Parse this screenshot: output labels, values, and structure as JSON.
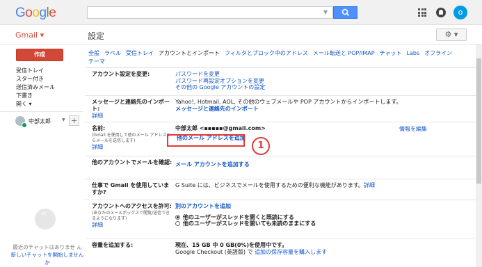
{
  "header": {
    "logo_text": "Google",
    "search_placeholder": "",
    "avatar_initial": "o"
  },
  "subbar": {
    "app_label": "Gmail ▾",
    "page_title": "設定",
    "gear_label": "⚙ ▾"
  },
  "sidebar": {
    "compose_label": "作成",
    "items": [
      {
        "label": "受信トレイ"
      },
      {
        "label": "スター付き"
      },
      {
        "label": "送信済みメール"
      },
      {
        "label": "下書き"
      },
      {
        "label": "開く ▾"
      }
    ],
    "user_name": "中部太郎",
    "user_caret": "▼",
    "add_label": "+",
    "chat_empty_text": "最近のチャットはありませ ん",
    "chat_start_link": "新しいチャットを開始しません か"
  },
  "tabs": [
    {
      "label": "全般"
    },
    {
      "label": "ラベル"
    },
    {
      "label": "受信トレイ"
    },
    {
      "label": "アカウントとインポート",
      "active": true
    },
    {
      "label": "フィルタとブロック中のアドレス"
    },
    {
      "label": "メール転送と POP/IMAP"
    },
    {
      "label": "チャット"
    },
    {
      "label": "Labs"
    },
    {
      "label": "オフライン"
    },
    {
      "label": "テーマ"
    }
  ],
  "rows": {
    "account_settings": {
      "label": "アカウント設定を変更:",
      "link1": "パスワードを変更",
      "link2": "パスワード再設定オプションを変更",
      "link3": "その他の Google アカウントの設定"
    },
    "import": {
      "label": "メッセージと連絡先のインポート:",
      "detail_link": "詳細",
      "text": "Yahoo!, Hotmail, AOL, その他のウェブメールや POP アカウントからインポートします。",
      "action": "メッセージと連絡先のインポート"
    },
    "name": {
      "label": "名前:",
      "note": "(Gmail を使用して他のメール アドレスからメールを送信します)",
      "detail_link": "詳細",
      "address": "中部太郎 <▪▪▪▪▪@gmail.com>",
      "edit_link": "情報を編集",
      "add_link": "他のメール アドレスを追加"
    },
    "check_mail": {
      "label": "他のアカウントでメールを確認:",
      "action": "メール アカウントを追加する"
    },
    "work": {
      "label": "仕事で Gmail を使用していますか?",
      "text": "G Suite には、ビジネスでメールを使用するための便利な機能があります。",
      "link": "詳細"
    },
    "grant": {
      "label": "アカウントへのアクセスを許可:",
      "note": "(あなたのメールボックスで閲覧/送信できるようになります)",
      "detail_link": "詳細",
      "action": "別のアカウントを追加",
      "option1": "他のユーザーがスレッドを開くと既読にする",
      "option2": "他のユーザーがスレッドを開いても未読のままにする"
    },
    "storage": {
      "label": "容量を追加する:",
      "text": "現在、15 GB 中 0 GB(0%)を使用中です。",
      "text2_prefix": "Google Checkout (英語版) で",
      "text2_link": "追加の保存容量を購入します"
    }
  },
  "annotation": {
    "number": "1"
  }
}
